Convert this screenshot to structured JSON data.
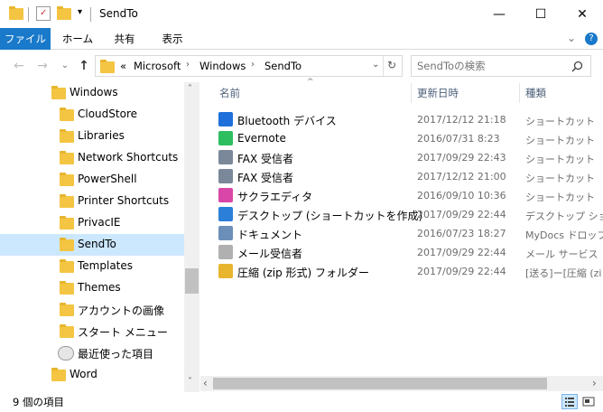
{
  "window": {
    "title": "SendTo",
    "minimize": "—",
    "maximize": "☐",
    "close": "✕"
  },
  "ribbon": {
    "tabs": [
      "ファイル",
      "ホーム",
      "共有",
      "表示"
    ],
    "expand": "⌄",
    "help": "?"
  },
  "address": {
    "prefix": "«",
    "crumbs": [
      "Microsoft",
      "Windows",
      "SendTo"
    ],
    "separator": "›",
    "dropdown": "⌄",
    "refresh": "↻"
  },
  "search": {
    "placeholder": "SendToの検索",
    "icon": "search-icon"
  },
  "nav": {
    "back": "←",
    "forward": "→",
    "recent": "⌄",
    "up": "↑",
    "items": [
      {
        "label": "Windows",
        "indent": 0,
        "selected": false
      },
      {
        "label": "CloudStore",
        "indent": 1,
        "selected": false
      },
      {
        "label": "Libraries",
        "indent": 1,
        "selected": false
      },
      {
        "label": "Network Shortcuts",
        "indent": 1,
        "selected": false
      },
      {
        "label": "PowerShell",
        "indent": 1,
        "selected": false
      },
      {
        "label": "Printer Shortcuts",
        "indent": 1,
        "selected": false
      },
      {
        "label": "PrivacIE",
        "indent": 1,
        "selected": false
      },
      {
        "label": "SendTo",
        "indent": 1,
        "selected": true
      },
      {
        "label": "Templates",
        "indent": 1,
        "selected": false
      },
      {
        "label": "Themes",
        "indent": 1,
        "selected": false
      },
      {
        "label": "アカウントの画像",
        "indent": 1,
        "selected": false
      },
      {
        "label": "スタート メニュー",
        "indent": 1,
        "selected": false
      },
      {
        "label": "最近使った項目",
        "indent": 1,
        "selected": false
      },
      {
        "label": "Word",
        "indent": 0,
        "selected": false
      }
    ],
    "scroll_up": "˄",
    "scroll_down": "˅"
  },
  "list": {
    "sort_indicator": "^",
    "columns": [
      "名前",
      "更新日時",
      "種類"
    ],
    "rows": [
      {
        "name": "Bluetooth デバイス",
        "date": "2017/12/12 21:18",
        "type": "ショートカット",
        "icon": "bluetooth-icon",
        "color": "#1e6fd9"
      },
      {
        "name": "Evernote",
        "date": "2016/07/31 8:23",
        "type": "ショートカット",
        "icon": "evernote-icon",
        "color": "#2dbe60"
      },
      {
        "name": "FAX 受信者",
        "date": "2017/09/29 22:43",
        "type": "ショートカット",
        "icon": "fax-icon",
        "color": "#7a8899"
      },
      {
        "name": "FAX 受信者",
        "date": "2017/12/12 21:00",
        "type": "ショートカット",
        "icon": "fax-icon",
        "color": "#7a8899"
      },
      {
        "name": "サクラエディタ",
        "date": "2016/09/10 10:36",
        "type": "ショートカット",
        "icon": "sakura-editor-icon",
        "color": "#d946a8"
      },
      {
        "name": "デスクトップ (ショートカットを作成)",
        "date": "2017/09/29 22:44",
        "type": "デスクトップ ショート",
        "icon": "desktop-icon",
        "color": "#2b7fd8"
      },
      {
        "name": "ドキュメント",
        "date": "2016/07/23 18:27",
        "type": "MyDocs ドロップ ·",
        "icon": "document-icon",
        "color": "#6b8fb8"
      },
      {
        "name": "メール受信者",
        "date": "2017/09/29 22:44",
        "type": "メール サービス",
        "icon": "mail-icon",
        "color": "#b0b0b0"
      },
      {
        "name": "圧縮 (zip 形式) フォルダー",
        "date": "2017/09/29 22:44",
        "type": "[送る]ー[圧縮 (zi",
        "icon": "zip-folder-icon",
        "color": "#e8b52e"
      }
    ],
    "hscroll_left": "‹",
    "hscroll_right": "›"
  },
  "status": {
    "count": "9 個の項目"
  },
  "colors": {
    "accent": "#1979ca",
    "selection": "#cce8ff",
    "folder": "#f4c542"
  }
}
